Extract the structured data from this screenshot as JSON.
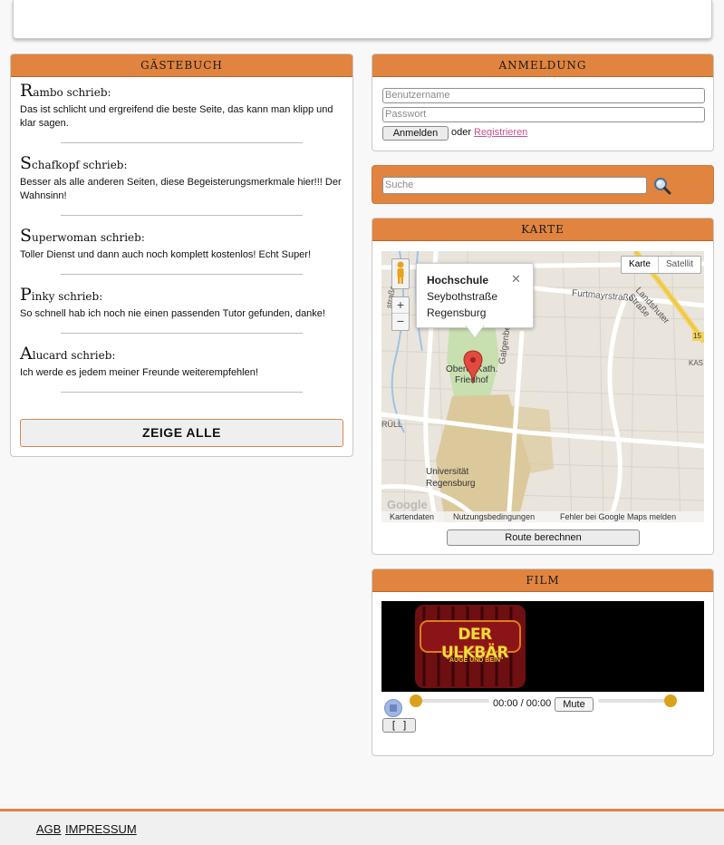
{
  "guestbook": {
    "title": "GÄSTEBUCH",
    "entries": [
      {
        "initial": "R",
        "rest": "ambo schrieb:",
        "text": "Das ist schlicht und ergreifend die beste Seite, das kann man klipp und klar sagen."
      },
      {
        "initial": "S",
        "rest": "chafkopf schrieb:",
        "text": "Besser als alle anderen Seiten, diese Begeisterungsmerkmale hier!!! Der Wahnsinn!"
      },
      {
        "initial": "S",
        "rest": "uperwoman schrieb:",
        "text": "Toller Dienst und dann auch noch komplett kostenlos! Echt Super!"
      },
      {
        "initial": "P",
        "rest": "inky schrieb:",
        "text": "So schnell hab ich noch nie einen passenden Tutor gefunden, danke!"
      },
      {
        "initial": "A",
        "rest": "lucard schrieb:",
        "text": "Ich werde es jedem meiner Freunde weiterempfehlen!"
      }
    ],
    "show_all_label": "ZEIGE ALLE"
  },
  "login": {
    "title": "ANMELDUNG",
    "username_placeholder": "Benutzername",
    "password_placeholder": "Passwort",
    "submit_label": "Anmelden",
    "or_text": "oder",
    "register_link": "Registrieren"
  },
  "search": {
    "placeholder": "Suche",
    "icon": "magnifier-icon"
  },
  "map": {
    "title": "KARTE",
    "type_buttons": [
      "Karte",
      "Satellit"
    ],
    "zoom_in": "+",
    "zoom_out": "−",
    "info": {
      "title": "Hochschule",
      "line1": "Seybothstraße",
      "line2": "Regensburg",
      "close": "✕"
    },
    "labels": {
      "furtmayr": "Furtmayrstraße",
      "landshuter": "Landshuter Straße",
      "galgenberg": "Galgenbergstraße",
      "friedhof1": "Oberer Kath.",
      "friedhof2": "Friedhof",
      "uni1": "Universität",
      "uni2": "Regensburg",
      "ruell": "RÜLL",
      "kas": "KAS",
      "strasse": "straße",
      "road15": "15",
      "google": "Google"
    },
    "attribution": [
      "Kartendaten",
      "Nutzungsbedingungen",
      "Fehler bei Google Maps melden"
    ],
    "route_button": "Route berechnen",
    "colors": {
      "land": "#e9e5dc",
      "park": "#c8dfb0",
      "campus": "#dcc99b",
      "road": "#ffffff",
      "highway": "#f2d35e",
      "water": "#9ec3e6",
      "marker": "#e04a3f"
    }
  },
  "film": {
    "title": "FILM",
    "logo_text": "DER ULKBÄR",
    "logo_sub": "\"AUGE UND BEIN\"",
    "time": "00:00 / 00:00",
    "mute_label": "Mute",
    "fullscreen_label": "[   ]",
    "volume": 1.0,
    "progress": 0.0,
    "colors": {
      "knob": "#d9a21b",
      "logo_fill": "#e8e03a",
      "logo_bg": "#8b1418"
    }
  },
  "footer": {
    "links": [
      "AGB",
      "IMPRESSUM"
    ]
  }
}
